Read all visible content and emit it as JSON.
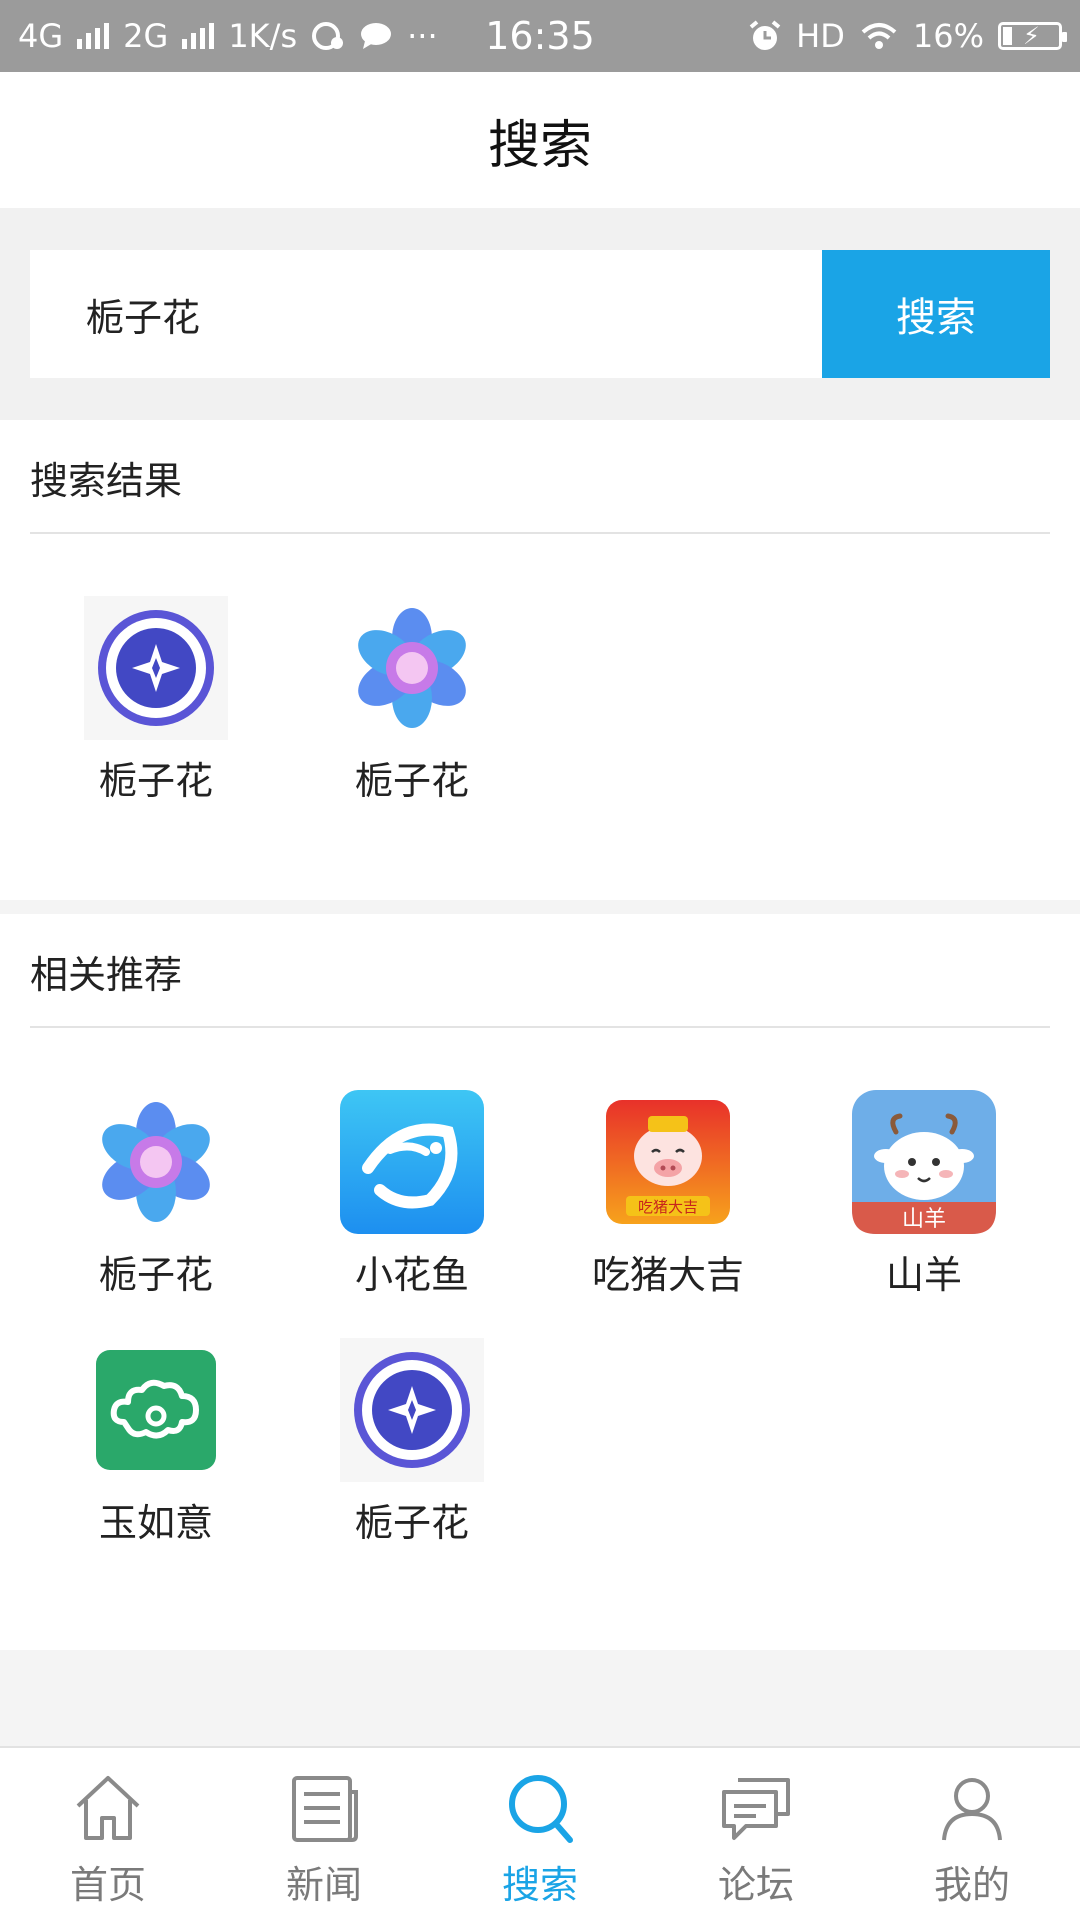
{
  "status_bar": {
    "network1": "4G",
    "network2": "2G",
    "speed": "1K/s",
    "dots": "···",
    "time": "16:35",
    "hd": "HD",
    "battery": "16%"
  },
  "header": {
    "title": "搜索"
  },
  "search": {
    "query": "栀子花",
    "button_label": "搜索"
  },
  "results": {
    "title": "搜索结果",
    "items": [
      {
        "label": "栀子花",
        "icon": "gardenia-coin-icon"
      },
      {
        "label": "栀子花",
        "icon": "gardenia-flower-icon"
      }
    ]
  },
  "recommend": {
    "title": "相关推荐",
    "items": [
      {
        "label": "栀子花",
        "icon": "gardenia-flower-icon"
      },
      {
        "label": "小花鱼",
        "icon": "fish-app-icon"
      },
      {
        "label": "吃猪大吉",
        "icon": "pig-app-icon",
        "icon_text": "吃猪大吉"
      },
      {
        "label": "山羊",
        "icon": "goat-app-icon",
        "icon_text": "山羊"
      },
      {
        "label": "玉如意",
        "icon": "cloud-app-icon"
      },
      {
        "label": "栀子花",
        "icon": "gardenia-coin-icon"
      }
    ]
  },
  "nav": {
    "items": [
      {
        "label": "首页",
        "icon": "home-icon"
      },
      {
        "label": "新闻",
        "icon": "news-icon"
      },
      {
        "label": "搜索",
        "icon": "search-icon",
        "active": true
      },
      {
        "label": "论坛",
        "icon": "forum-icon"
      },
      {
        "label": "我的",
        "icon": "profile-icon"
      }
    ]
  },
  "colors": {
    "accent": "#1aa4e6",
    "status_bar": "#9b9b9b",
    "nav_inactive": "#7a7a7a"
  }
}
